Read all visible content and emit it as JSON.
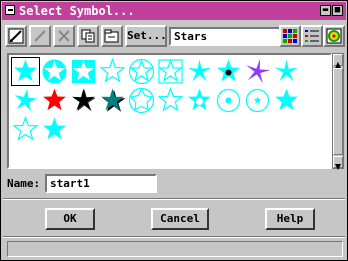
{
  "window": {
    "title": "Select Symbol...",
    "minimize_glyph": "▬",
    "close_glyph": "■"
  },
  "toolbar": {
    "set_label": "Set...",
    "set_value": "Stars",
    "icons": [
      "edit-icon",
      "delete-icon",
      "clear-icon",
      "copy-icon",
      "folder-icon",
      "grid-view-icon",
      "list-view-icon",
      "help-icon"
    ]
  },
  "symbols": [
    {
      "name": "star-cyan-filled",
      "style": "filled",
      "color": "#00ffff",
      "selected": true
    },
    {
      "name": "star-in-cyan-circle",
      "style": "in-circle",
      "color": "#00ffff"
    },
    {
      "name": "star-on-cyan-square-1",
      "style": "in-square",
      "color": "#00ffff"
    },
    {
      "name": "star-cyan-outline",
      "style": "outline",
      "color": "#00ffff"
    },
    {
      "name": "star-outline-in-circle",
      "style": "outline-circle",
      "color": "#00ffff"
    },
    {
      "name": "star-outline-in-square",
      "style": "outline-square",
      "color": "#00ffff"
    },
    {
      "name": "star-cyan-thin",
      "style": "thin",
      "color": "#00ffff"
    },
    {
      "name": "star-cyan-black-dot",
      "style": "dot",
      "color": "#00ffff"
    },
    {
      "name": "star-purple-burst",
      "style": "burst",
      "color": "#8b3cff"
    },
    {
      "name": "star-cyan-thin-2",
      "style": "thin",
      "color": "#00ffff"
    },
    {
      "name": "star-cyan-skew",
      "style": "skew",
      "color": "#00ffff"
    },
    {
      "name": "star-red",
      "style": "filled",
      "color": "#ff0000"
    },
    {
      "name": "star-black-shadow",
      "style": "shadow",
      "color": "#000000"
    },
    {
      "name": "star-teal-black",
      "style": "shadow2",
      "color": "#008080"
    },
    {
      "name": "star-pentagon-outline",
      "style": "pentagon",
      "color": "#00ffff"
    },
    {
      "name": "star-cyan-outline-2",
      "style": "outline",
      "color": "#00ffff"
    },
    {
      "name": "star-white-center",
      "style": "white-center",
      "color": "#00ffff"
    },
    {
      "name": "star-circle-dot",
      "style": "circle-dot",
      "color": "#00ffff"
    },
    {
      "name": "star-circle-small",
      "style": "circle-small",
      "color": "#00ffff"
    },
    {
      "name": "star-cyan-filled-2",
      "style": "filled",
      "color": "#00ffff"
    },
    {
      "name": "star-cyan-outline-3",
      "style": "outline",
      "color": "#00ffff"
    },
    {
      "name": "star-cyan-filled-3",
      "style": "filled",
      "color": "#00ffff"
    }
  ],
  "name_field": {
    "label": "Name:",
    "value": "start1"
  },
  "buttons": {
    "ok": "OK",
    "cancel": "Cancel",
    "help": "Help"
  },
  "colors": {
    "titlebar": "#c0409c",
    "background": "#c6c6c6",
    "accent_cyan": "#00ffff"
  }
}
